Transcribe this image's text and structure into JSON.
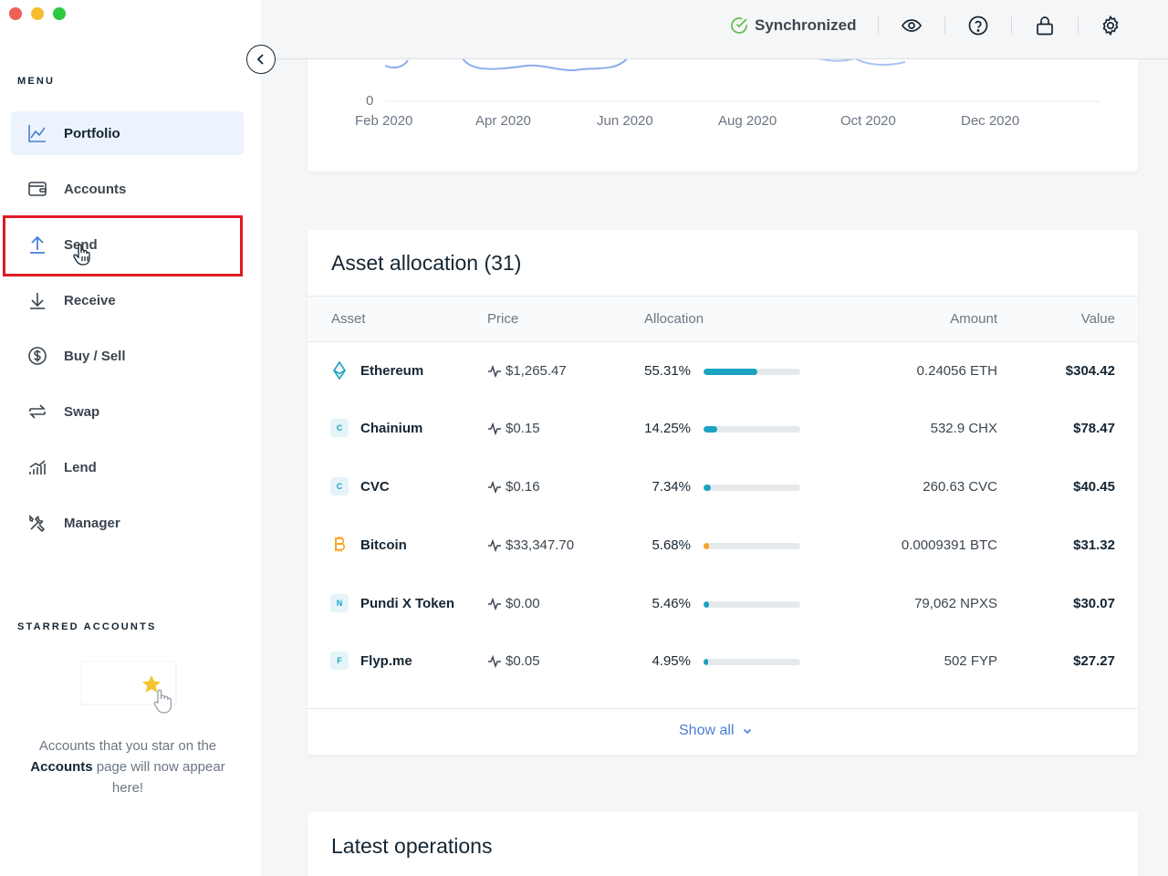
{
  "sidebar": {
    "menu_label": "MENU",
    "items": [
      {
        "label": "Portfolio",
        "icon": "chart-line-icon",
        "active": true
      },
      {
        "label": "Accounts",
        "icon": "wallet-icon"
      },
      {
        "label": "Send",
        "icon": "arrow-up-icon"
      },
      {
        "label": "Receive",
        "icon": "arrow-down-icon"
      },
      {
        "label": "Buy / Sell",
        "icon": "dollar-circle-icon"
      },
      {
        "label": "Swap",
        "icon": "swap-arrows-icon"
      },
      {
        "label": "Lend",
        "icon": "growth-chart-icon"
      },
      {
        "label": "Manager",
        "icon": "tools-icon"
      }
    ],
    "starred_label": "STARRED ACCOUNTS",
    "starred_text_1": "Accounts that you star on the",
    "starred_text_bold": "Accounts",
    "starred_text_2": "page will now appear here!"
  },
  "topbar": {
    "sync_label": "Synchronized",
    "icons": [
      "eye-icon",
      "help-icon",
      "lock-icon",
      "settings-icon"
    ]
  },
  "chart": {
    "zero_label": "0",
    "x_ticks": [
      "Feb 2020",
      "Apr 2020",
      "Jun 2020",
      "Aug 2020",
      "Oct 2020",
      "Dec 2020"
    ]
  },
  "allocation": {
    "title": "Asset allocation (31)",
    "columns": {
      "asset": "Asset",
      "price": "Price",
      "allocation": "Allocation",
      "amount": "Amount",
      "value": "Value"
    },
    "rows": [
      {
        "name": "Ethereum",
        "price": "$1,265.47",
        "pct_label": "55.31%",
        "pct": 55.31,
        "amount": "0.24056 ETH",
        "value": "$304.42",
        "icon": "ethereum-icon",
        "badge": "",
        "color": "#1aa3c1"
      },
      {
        "name": "Chainium",
        "price": "$0.15",
        "pct_label": "14.25%",
        "pct": 14.25,
        "amount": "532.9 CHX",
        "value": "$78.47",
        "icon": "chainium-badge-icon",
        "badge": "C",
        "color": "#1aa3c1"
      },
      {
        "name": "CVC",
        "price": "$0.16",
        "pct_label": "7.34%",
        "pct": 7.34,
        "amount": "260.63 CVC",
        "value": "$40.45",
        "icon": "cvc-badge-icon",
        "badge": "C",
        "color": "#1aa3c1"
      },
      {
        "name": "Bitcoin",
        "price": "$33,347.70",
        "pct_label": "5.68%",
        "pct": 5.68,
        "amount": "0.0009391 BTC",
        "value": "$31.32",
        "icon": "bitcoin-icon",
        "badge": "",
        "color": "#f5a623"
      },
      {
        "name": "Pundi X Token",
        "price": "$0.00",
        "pct_label": "5.46%",
        "pct": 5.46,
        "amount": "79,062 NPXS",
        "value": "$30.07",
        "icon": "pundix-badge-icon",
        "badge": "N",
        "color": "#1aa3c1"
      },
      {
        "name": "Flyp.me",
        "price": "$0.05",
        "pct_label": "4.95%",
        "pct": 4.95,
        "amount": "502 FYP",
        "value": "$27.27",
        "icon": "flyp-badge-icon",
        "badge": "F",
        "color": "#1aa3c1"
      }
    ],
    "show_all": "Show all"
  },
  "operations": {
    "title": "Latest operations"
  }
}
